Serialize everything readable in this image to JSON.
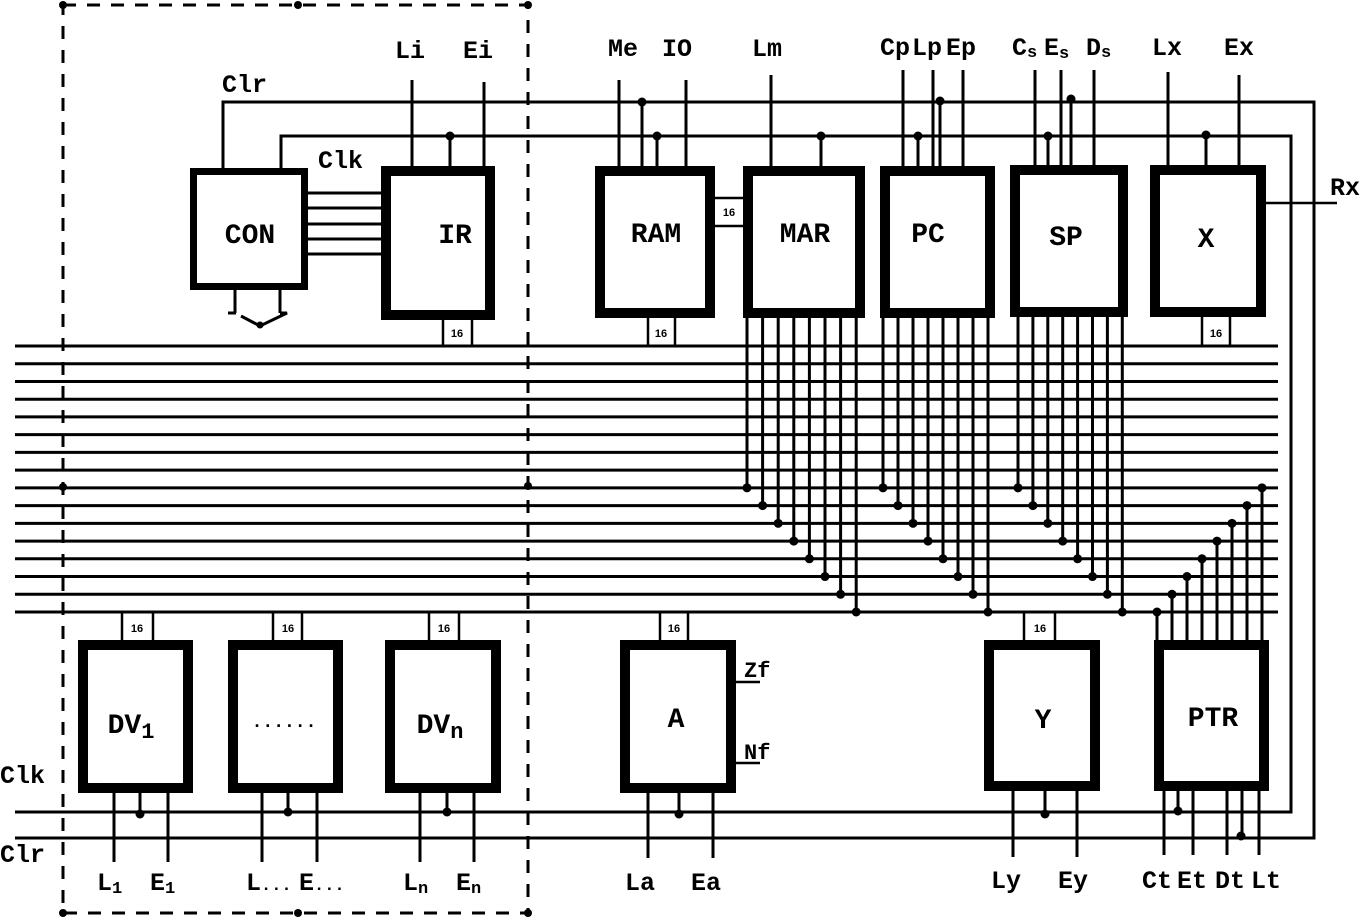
{
  "colors": {
    "ink": "#000000",
    "background": "#ffffff"
  },
  "registers": {
    "con": "CON",
    "ir": "IR",
    "ram": "RAM",
    "mar": "MAR",
    "pc": "PC",
    "sp": "SP",
    "x": "X",
    "dv1": {
      "main": "DV",
      "sub": "1"
    },
    "dv_ellipsis": "......",
    "dvn": {
      "main": "DV",
      "sub": "n"
    },
    "a": "A",
    "y": "Y",
    "ptr": "PTR"
  },
  "bus": {
    "width_label": "16",
    "line_count": 16
  },
  "global_signals": {
    "clr": "Clr",
    "clk": "Clk"
  },
  "top_signals": {
    "ir": [
      "Li",
      "Ei"
    ],
    "ram": [
      "Me",
      "IO"
    ],
    "mar": [
      "Lm"
    ],
    "pc": [
      "Cp",
      "Lp",
      "Ep"
    ],
    "sp": [
      {
        "main": "C",
        "sub": "s"
      },
      {
        "main": "E",
        "sub": "s"
      },
      {
        "main": "D",
        "sub": "s"
      }
    ],
    "x": [
      "Lx",
      "Ex"
    ],
    "x_output": "Rx"
  },
  "a_flags": [
    "Zf",
    "Nf"
  ],
  "bottom_signals": {
    "dv1": [
      {
        "main": "L",
        "sub": "1"
      },
      {
        "main": "E",
        "sub": "1"
      }
    ],
    "dv_ellipsis": [
      {
        "main": "L",
        "sub": "..."
      },
      {
        "main": "E",
        "sub": "..."
      }
    ],
    "dvn": [
      {
        "main": "L",
        "sub": "n"
      },
      {
        "main": "E",
        "sub": "n"
      }
    ],
    "a": [
      "La",
      "Ea"
    ],
    "y": [
      "Ly",
      "Ey"
    ],
    "ptr": [
      "Ct",
      "Et",
      "Dt",
      "Lt"
    ]
  }
}
